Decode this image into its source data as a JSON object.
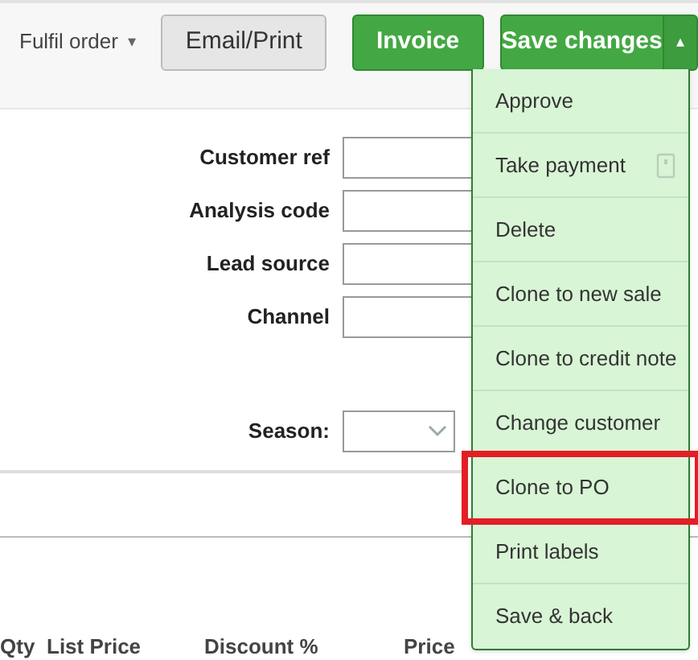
{
  "toolbar": {
    "fulfil_menu": {
      "label": "Fulfil order",
      "caret": "▾"
    },
    "buttons": [
      {
        "label": "Email/Print",
        "kind": "secondary"
      },
      {
        "label": "Invoice",
        "kind": "primary"
      }
    ],
    "save_button": {
      "label": "Save changes",
      "caret": "▴",
      "expanded": true
    }
  },
  "save_menu": [
    {
      "label": "Approve",
      "highlighted": false
    },
    {
      "label": "Take payment",
      "highlighted": false,
      "has_icon": true
    },
    {
      "label": "Delete",
      "highlighted": false
    },
    {
      "label": "Clone to new sale",
      "highlighted": false
    },
    {
      "label": "Clone to credit note",
      "highlighted": false
    },
    {
      "label": "Change customer",
      "highlighted": false
    },
    {
      "label": "Clone to PO",
      "highlighted": true
    },
    {
      "label": "Print labels",
      "highlighted": false
    },
    {
      "label": "Save & back",
      "highlighted": false
    }
  ],
  "form": {
    "fields": [
      {
        "label": "Customer ref"
      },
      {
        "label": "Analysis code"
      },
      {
        "label": "Lead source"
      },
      {
        "label": "Channel"
      }
    ],
    "season": {
      "label": "Season:",
      "kind": "select"
    }
  },
  "table": {
    "columns": [
      "Qty",
      "List Price",
      "Discount %",
      "Price"
    ]
  }
}
